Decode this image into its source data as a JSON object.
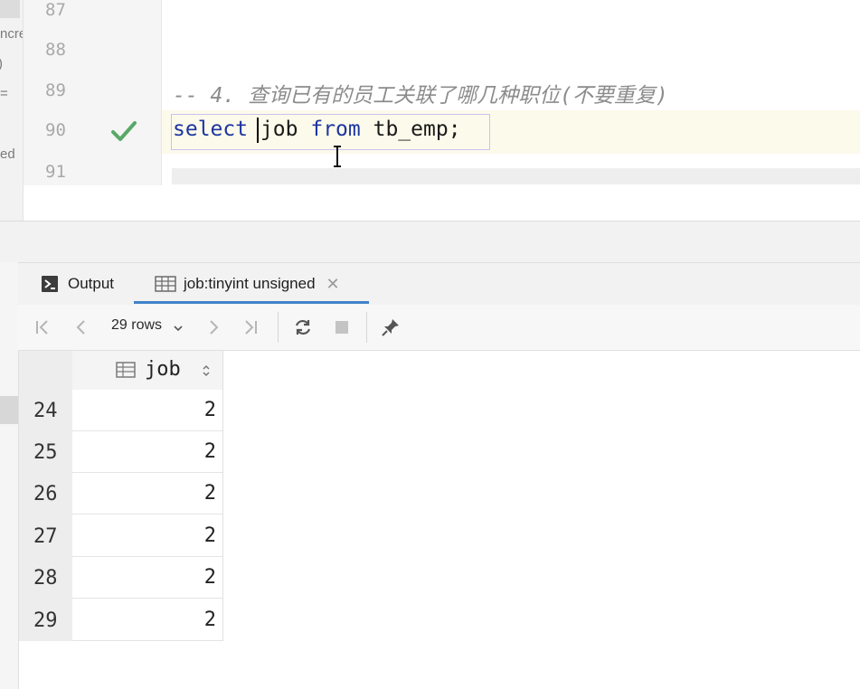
{
  "left_panel": {
    "fragments": [
      "ncre",
      "=",
      "ed"
    ]
  },
  "editor": {
    "line_numbers": [
      "87",
      "88",
      "89",
      "90",
      "91"
    ],
    "comment_line": "-- 4. 查询已有的员工关联了哪几种职位(不要重复)",
    "statement": {
      "kw_select": "select",
      "col": "job",
      "kw_from": "from",
      "table": "tb_emp",
      "semicolon": ";"
    },
    "status_icon": "check-icon"
  },
  "result_panel": {
    "tabs": [
      {
        "label": "Output",
        "icon": "output-icon",
        "active": false
      },
      {
        "label": "job:tinyint unsigned",
        "icon": "table-icon",
        "active": true,
        "closable": true
      }
    ],
    "toolbar": {
      "rows_label": "29 rows",
      "icons": [
        "first-page-icon",
        "prev-page-icon",
        "next-page-icon",
        "last-page-icon",
        "refresh-icon",
        "stop-icon",
        "pin-icon"
      ]
    },
    "grid": {
      "column": "job",
      "rows": [
        {
          "num": "24",
          "job": "2"
        },
        {
          "num": "25",
          "job": "2"
        },
        {
          "num": "26",
          "job": "2"
        },
        {
          "num": "27",
          "job": "2"
        },
        {
          "num": "28",
          "job": "2"
        },
        {
          "num": "29",
          "job": "2"
        }
      ]
    }
  },
  "colors": {
    "keyword": "#1d35a0",
    "comment": "#8c8c8c",
    "check": "#59a869",
    "active_tab_underline": "#4083c9"
  }
}
